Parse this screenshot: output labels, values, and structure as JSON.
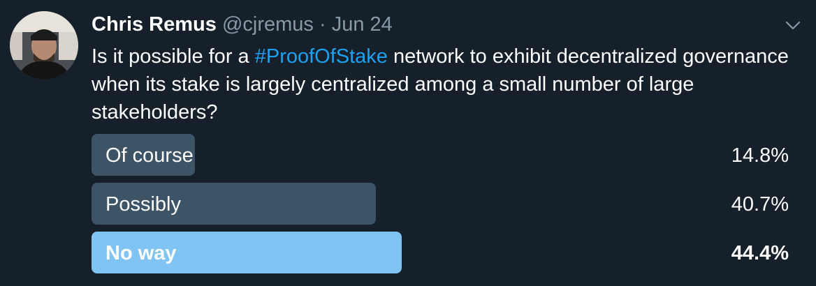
{
  "tweet": {
    "author_name": "Chris Remus",
    "handle": "@cjremus",
    "separator": "·",
    "date": "Jun 24",
    "text_before": "Is it possible for a ",
    "hashtag": "#ProofOfStake",
    "text_after": " network to exhibit decentralized governance when its stake is largely centralized among a small number of large stakeholders?"
  },
  "poll": {
    "options": [
      {
        "label": "Of course",
        "percent_text": "14.8%",
        "percent": 14.8,
        "winner": false
      },
      {
        "label": "Possibly",
        "percent_text": "40.7%",
        "percent": 40.7,
        "winner": false
      },
      {
        "label": "No way",
        "percent_text": "44.4%",
        "percent": 44.4,
        "winner": true
      }
    ]
  },
  "colors": {
    "background": "#15202b",
    "muted_text": "#8899a6",
    "hashtag": "#1da1f2",
    "bar": "#3d5466",
    "winner_bar": "#7fc4f2"
  },
  "icons": {
    "menu": "chevron-down-icon"
  }
}
